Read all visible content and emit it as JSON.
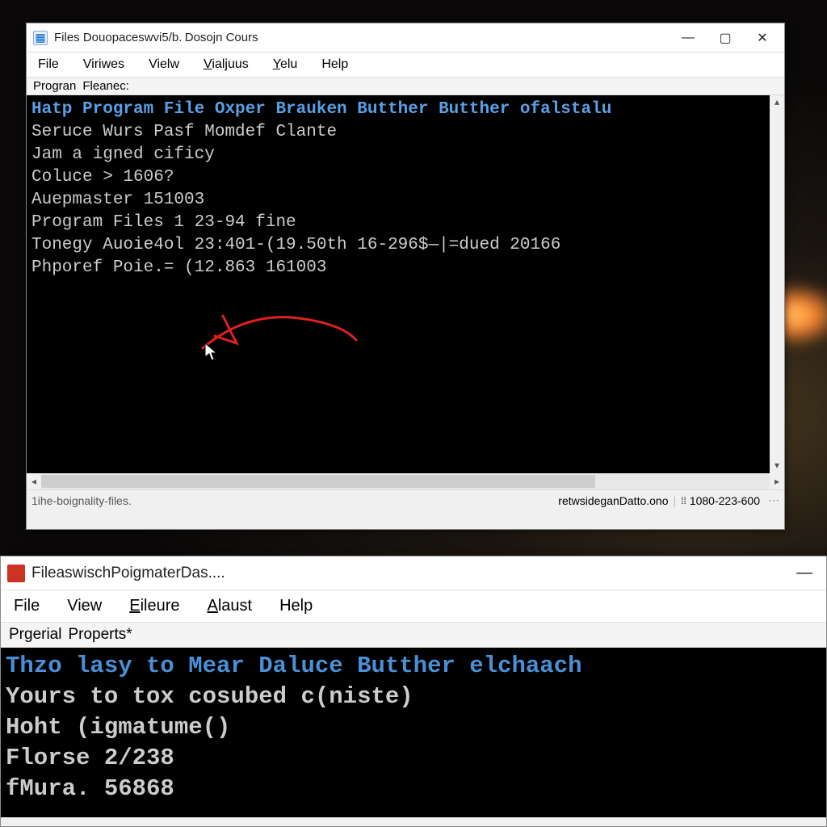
{
  "window1": {
    "title": "Files Douopaceswvi5/b. Dosojn Cours",
    "menubar": [
      "File",
      "Viriwes",
      "Vielw",
      "Vialjuus",
      "Yelu",
      "Help"
    ],
    "menubar_underline": [
      0,
      0,
      0,
      1,
      1,
      0
    ],
    "toolbar": [
      "Progran",
      "Fleanec:"
    ],
    "terminal": {
      "lines": [
        {
          "class": "term-blue",
          "text": "Hatp Program File Oxper Brauken Butther Butther ofalstalu"
        },
        {
          "class": "",
          "text": "Seruce Wurs Pasf Momdef Clante"
        },
        {
          "class": "",
          "text": "Jam a igned cificy"
        },
        {
          "class": "",
          "text": "Coluce > 1606?"
        },
        {
          "class": "",
          "text": "Auepmaster 151003"
        },
        {
          "class": "",
          "text": ""
        },
        {
          "class": "",
          "text": ""
        },
        {
          "class": "",
          "text": "Program Files 1 23-94 fine"
        },
        {
          "class": "",
          "text": "Tonegy Auoie4ol 23:401-(19.50th 16-296$—|=dued 20166"
        },
        {
          "class": "",
          "text": "Phporef Poie.= (12.863 161003"
        }
      ]
    },
    "statusbar": {
      "left": "1ihe-boignality-files.",
      "right1": "retwsideganDatto.ono",
      "right2": "1080-223-600",
      "more": "⋯"
    }
  },
  "window2": {
    "title": "FileaswischPoigmaterDas....",
    "menubar": [
      "File",
      "View",
      "Eileure",
      "Alaust",
      "Help"
    ],
    "menubar_underline": [
      0,
      0,
      1,
      1,
      0
    ],
    "toolbar": [
      "Prgerial",
      "Properts*"
    ],
    "terminal": {
      "lines": [
        {
          "class": "term-blue2",
          "text": "Thzo lasy to Mear Daluce Butther elchaach"
        },
        {
          "class": "",
          "text": "Yours to tox cosubed c(niste)"
        },
        {
          "class": "",
          "text": "Hoht (igmatume()"
        },
        {
          "class": "",
          "text": "Florse 2/238"
        },
        {
          "class": "",
          "text": "fMura. 56868"
        }
      ]
    }
  }
}
